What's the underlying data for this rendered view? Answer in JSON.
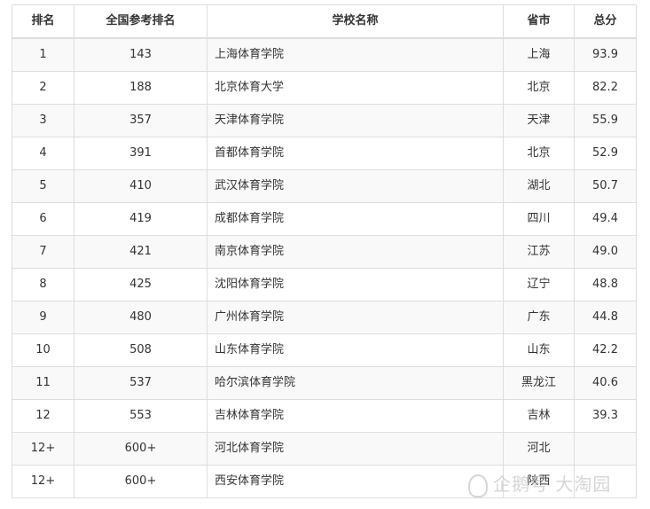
{
  "headers": [
    "排名",
    "全国参考排名",
    "学校名称",
    "省市",
    "总分"
  ],
  "rows": [
    [
      "1",
      "143",
      "上海体育学院",
      "上海",
      "93.9"
    ],
    [
      "2",
      "188",
      "北京体育大学",
      "北京",
      "82.2"
    ],
    [
      "3",
      "357",
      "天津体育学院",
      "天津",
      "55.9"
    ],
    [
      "4",
      "391",
      "首都体育学院",
      "北京",
      "52.9"
    ],
    [
      "5",
      "410",
      "武汉体育学院",
      "湖北",
      "50.7"
    ],
    [
      "6",
      "419",
      "成都体育学院",
      "四川",
      "49.4"
    ],
    [
      "7",
      "421",
      "南京体育学院",
      "江苏",
      "49.0"
    ],
    [
      "8",
      "425",
      "沈阳体育学院",
      "辽宁",
      "48.8"
    ],
    [
      "9",
      "480",
      "广州体育学院",
      "广东",
      "44.8"
    ],
    [
      "10",
      "508",
      "山东体育学院",
      "山东",
      "42.2"
    ],
    [
      "11",
      "537",
      "哈尔滨体育学院",
      "黑龙江",
      "40.6"
    ],
    [
      "12",
      "553",
      "吉林体育学院",
      "吉林",
      "39.3"
    ],
    [
      "12+",
      "600+",
      "河北体育学院",
      "河北",
      ""
    ],
    [
      "12+",
      "600+",
      "西安体育学院",
      "陕西",
      ""
    ]
  ],
  "watermark": "企鹅号 大淘园"
}
